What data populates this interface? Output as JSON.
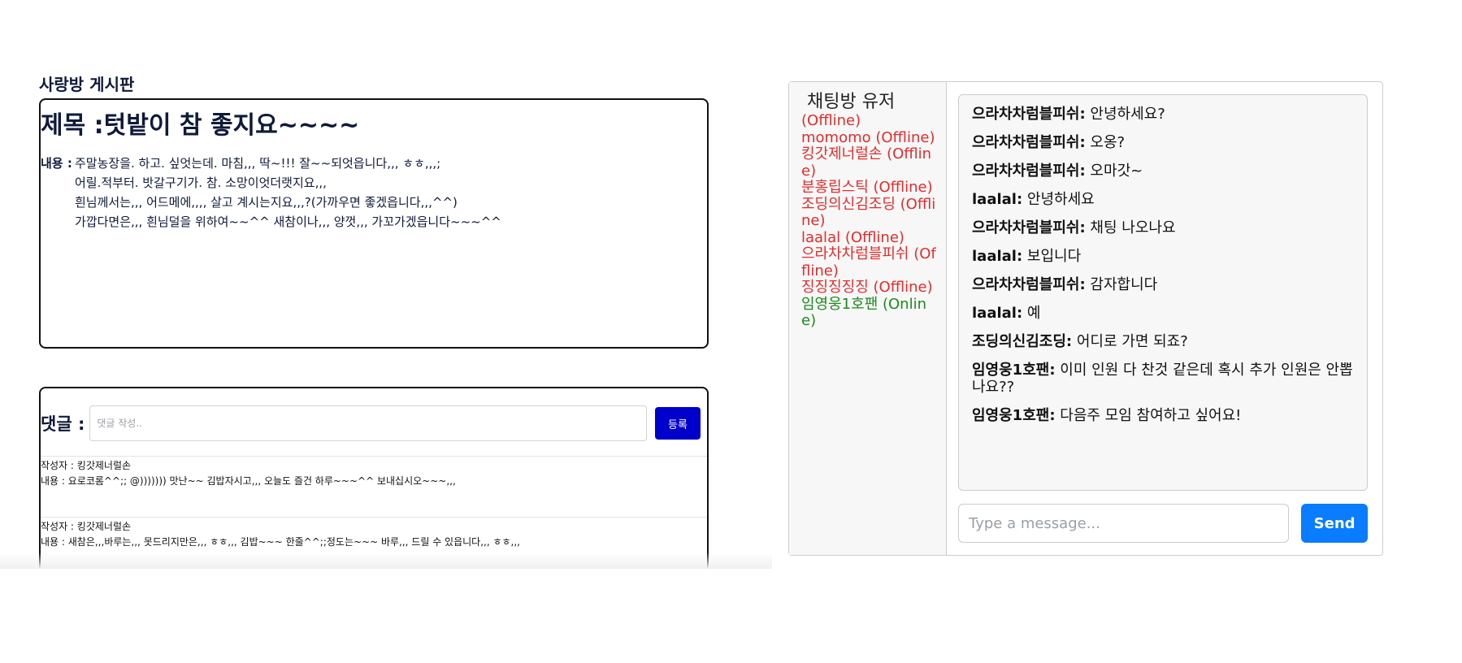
{
  "board": {
    "heading": "사랑방 게시판",
    "post": {
      "title": "제목 :텃밭이 참 좋지요~~~~",
      "content_label": "내용 :",
      "content_lines": [
        "주말농장을. 하고. 싶엇는데. 마침,,, 딱~!!! 잘~~되엇읍니다,,, ㅎㅎ,,,;",
        "어릴.적부터. 밧갈구기가. 참. 소망이엇더랫지요,,,",
        "흰님께서는,,, 어드메에,,,, 살고 계시는지요,,,?(가까우면 좋겠읍니다,,,^^)",
        "가깝다면은,,, 흰님덜을 위하여~~^^ 새참이나,,, 양껏,,, 가꼬가겠읍니다~~~^^"
      ]
    },
    "comment_form": {
      "label": "댓글 :",
      "placeholder": "댓글 작성..",
      "submit_label": "등록"
    },
    "comments": [
      {
        "author": "작성자 : 킹갓제너럴손",
        "content": "내용 : 요로코롬^^;; @))))))) 맛난~~ 김밥자시고,,, 오늘도 즐건 하루~~~^^ 보내십시오~~~,,,"
      },
      {
        "author": "작성자 : 킹갓제너럴손",
        "content": "내용 : 새참은,,,바루는,,, 못드리지만은,,, ㅎㅎ,,, 김밥~~~ 한줄^^;;정도는~~~ 바루,,, 드릴 수 있읍니다,,, ㅎㅎ,,,"
      }
    ]
  },
  "chat": {
    "user_list_title": "채팅방 유저",
    "users": [
      {
        "text": "(Offline)",
        "status": "offline"
      },
      {
        "text": "momomo (Offline)",
        "status": "offline"
      },
      {
        "text": "킹갓제너럴손 (Offline)",
        "status": "offline"
      },
      {
        "text": "분홍립스틱 (Offline)",
        "status": "offline"
      },
      {
        "text": "조딩의신김조딩 (Offline)",
        "status": "offline"
      },
      {
        "text": "laalal (Offline)",
        "status": "offline"
      },
      {
        "text": "으라차차럼블피쉬 (Offline)",
        "status": "offline"
      },
      {
        "text": "징징징징징 (Offline)",
        "status": "offline"
      },
      {
        "text": "임영웅1호팬 (Online)",
        "status": "online"
      }
    ],
    "messages": [
      {
        "sender": "으라차차럼블피쉬:",
        "text": "안녕하세요?"
      },
      {
        "sender": "으라차차럼블피쉬:",
        "text": "오옹?"
      },
      {
        "sender": "으라차차럼블피쉬:",
        "text": "오마갓~"
      },
      {
        "sender": "laalal:",
        "text": "안녕하세요"
      },
      {
        "sender": "으라차차럼블피쉬:",
        "text": "채팅 나오나요"
      },
      {
        "sender": "laalal:",
        "text": "보입니다"
      },
      {
        "sender": "으라차차럼블피쉬:",
        "text": "감자합니다"
      },
      {
        "sender": "laalal:",
        "text": "예"
      },
      {
        "sender": "조딩의신김조딩:",
        "text": "어디로 가면 되죠?"
      },
      {
        "sender": "임영웅1호팬:",
        "text": "이미 인원 다 찬것 같은데 혹시 추가 인원은 안뽑나요??"
      },
      {
        "sender": "임영웅1호팬:",
        "text": "다음주 모임 참여하고 싶어요!"
      }
    ],
    "input_placeholder": "Type a message...",
    "send_label": "Send"
  },
  "colors": {
    "offline": "#e02d2d",
    "online": "#1c8a1c",
    "comment_submit_bg": "#0000cc",
    "send_button_bg": "#0a7cff",
    "heading_text": "#0f1a3a"
  }
}
